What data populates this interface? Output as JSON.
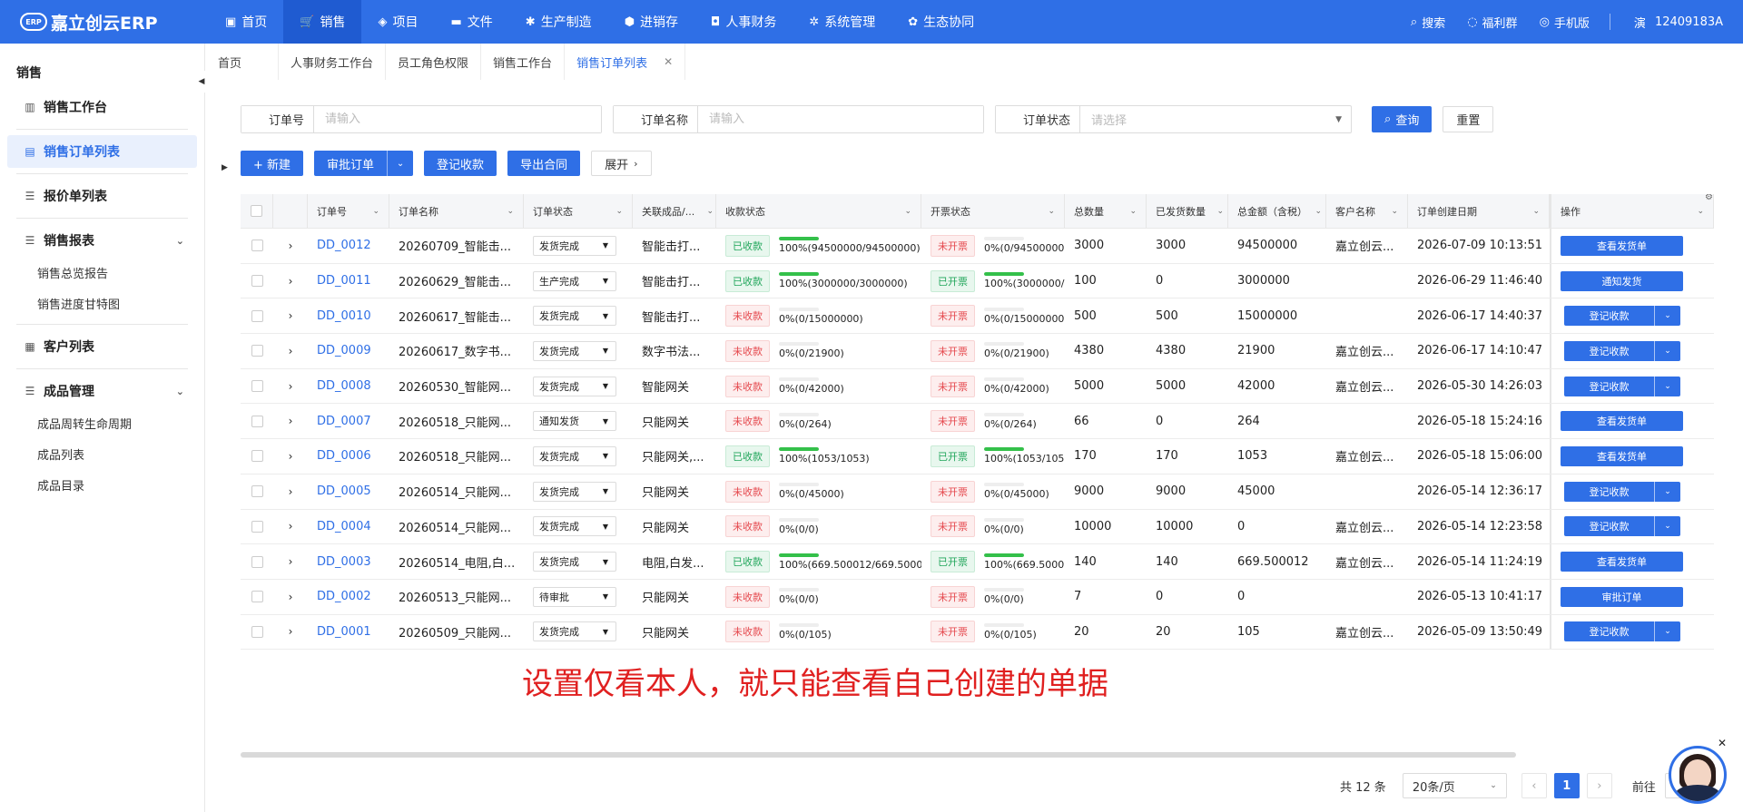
{
  "app": {
    "logo_badge": "ERP",
    "logo_text": "嘉立创云ERP"
  },
  "nav": [
    {
      "label": "首页",
      "icon": "monitor-icon",
      "glyph": "▣"
    },
    {
      "label": "销售",
      "icon": "cart-icon",
      "glyph": "🛒"
    },
    {
      "label": "项目",
      "icon": "layers-icon",
      "glyph": "◈"
    },
    {
      "label": "文件",
      "icon": "folder-icon",
      "glyph": "▬"
    },
    {
      "label": "生产制造",
      "icon": "gear-icon",
      "glyph": "✱"
    },
    {
      "label": "进销存",
      "icon": "box-icon",
      "glyph": "⬢"
    },
    {
      "label": "人事财务",
      "icon": "badge-icon",
      "glyph": "◘"
    },
    {
      "label": "系统管理",
      "icon": "settings-icon",
      "glyph": "✲"
    },
    {
      "label": "生态协同",
      "icon": "network-icon",
      "glyph": "✿"
    }
  ],
  "top_right": {
    "search": "搜索",
    "welfare": "福利群",
    "mobile": "手机版",
    "user_badge": "演",
    "user_id": "12409183A"
  },
  "sidebar": {
    "title": "销售",
    "items": [
      {
        "label": "销售工作台",
        "icon": "chart-icon"
      },
      {
        "label": "销售订单列表",
        "icon": "document-icon"
      },
      {
        "label": "报价单列表",
        "icon": "list-icon"
      }
    ],
    "report_group": {
      "label": "销售报表",
      "subs": [
        "销售总览报告",
        "销售进度甘特图"
      ]
    },
    "customer": {
      "label": "客户列表"
    },
    "product_group": {
      "label": "成品管理",
      "subs": [
        "成品周转生命周期",
        "成品列表",
        "成品目录"
      ]
    }
  },
  "tabs": [
    "首页",
    "人事财务工作台",
    "员工角色权限",
    "销售工作台",
    "销售订单列表"
  ],
  "filter": {
    "order_no_label": "订单号",
    "order_no_placeholder": "请输入",
    "order_name_label": "订单名称",
    "order_name_placeholder": "请输入",
    "order_status_label": "订单状态",
    "order_status_placeholder": "请选择",
    "query": "查询",
    "reset": "重置"
  },
  "actions": {
    "new": "+ 新建",
    "approve": "审批订单",
    "register_payment": "登记收款",
    "export_contract": "导出合同",
    "expand": "展开"
  },
  "columns": [
    "订单号",
    "订单名称",
    "订单状态",
    "关联成品/...",
    "收款状态",
    "开票状态",
    "总数量",
    "已发货数量",
    "总金额（含税）",
    "客户名称",
    "订单创建日期",
    "操作"
  ],
  "rows": [
    {
      "no": "DD_0012",
      "name": "20260709_智能击...",
      "status": "发货完成",
      "prod": "智能击打...",
      "pay_tag": "已收款",
      "pay_ok": true,
      "pay_pct": 1.0,
      "pay_text": "100%(94500000/94500000)",
      "inv_tag": "未开票",
      "inv_ok": false,
      "inv_pct": 0,
      "inv_text": "0%(0/94500000",
      "qty": "3000",
      "ship": "3000",
      "amt": "94500000",
      "cust": "嘉立创云...",
      "date": "2026-07-09 10:13:51",
      "op": "查看发货单",
      "op_split": false
    },
    {
      "no": "DD_0011",
      "name": "20260629_智能击...",
      "status": "生产完成",
      "prod": "智能击打...",
      "pay_tag": "已收款",
      "pay_ok": true,
      "pay_pct": 1.0,
      "pay_text": "100%(3000000/3000000)",
      "inv_tag": "已开票",
      "inv_ok": true,
      "inv_pct": 1.0,
      "inv_text": "100%(3000000/",
      "qty": "100",
      "ship": "0",
      "amt": "3000000",
      "cust": "",
      "date": "2026-06-29 11:46:40",
      "op": "通知发货",
      "op_split": false
    },
    {
      "no": "DD_0010",
      "name": "20260617_智能击...",
      "status": "发货完成",
      "prod": "智能击打...",
      "pay_tag": "未收款",
      "pay_ok": false,
      "pay_pct": 0,
      "pay_text": "0%(0/15000000)",
      "inv_tag": "未开票",
      "inv_ok": false,
      "inv_pct": 0,
      "inv_text": "0%(0/15000000",
      "qty": "500",
      "ship": "500",
      "amt": "15000000",
      "cust": "",
      "date": "2026-06-17 14:40:37",
      "op": "登记收款",
      "op_split": true
    },
    {
      "no": "DD_0009",
      "name": "20260617_数字书...",
      "status": "发货完成",
      "prod": "数字书法...",
      "pay_tag": "未收款",
      "pay_ok": false,
      "pay_pct": 0,
      "pay_text": "0%(0/21900)",
      "inv_tag": "未开票",
      "inv_ok": false,
      "inv_pct": 0,
      "inv_text": "0%(0/21900)",
      "qty": "4380",
      "ship": "4380",
      "amt": "21900",
      "cust": "嘉立创云...",
      "date": "2026-06-17 14:10:47",
      "op": "登记收款",
      "op_split": true
    },
    {
      "no": "DD_0008",
      "name": "20260530_智能网...",
      "status": "发货完成",
      "prod": "智能网关",
      "pay_tag": "未收款",
      "pay_ok": false,
      "pay_pct": 0,
      "pay_text": "0%(0/42000)",
      "inv_tag": "未开票",
      "inv_ok": false,
      "inv_pct": 0,
      "inv_text": "0%(0/42000)",
      "qty": "5000",
      "ship": "5000",
      "amt": "42000",
      "cust": "嘉立创云...",
      "date": "2026-05-30 14:26:03",
      "op": "登记收款",
      "op_split": true
    },
    {
      "no": "DD_0007",
      "name": "20260518_只能网...",
      "status": "通知发货",
      "prod": "只能网关",
      "pay_tag": "未收款",
      "pay_ok": false,
      "pay_pct": 0,
      "pay_text": "0%(0/264)",
      "inv_tag": "未开票",
      "inv_ok": false,
      "inv_pct": 0,
      "inv_text": "0%(0/264)",
      "qty": "66",
      "ship": "0",
      "amt": "264",
      "cust": "",
      "date": "2026-05-18 15:24:16",
      "op": "查看发货单",
      "op_split": false
    },
    {
      "no": "DD_0006",
      "name": "20260518_只能网...",
      "status": "发货完成",
      "prod": "只能网关,...",
      "pay_tag": "已收款",
      "pay_ok": true,
      "pay_pct": 1.0,
      "pay_text": "100%(1053/1053)",
      "inv_tag": "已开票",
      "inv_ok": true,
      "inv_pct": 1.0,
      "inv_text": "100%(1053/105",
      "qty": "170",
      "ship": "170",
      "amt": "1053",
      "cust": "嘉立创云...",
      "date": "2026-05-18 15:06:00",
      "op": "查看发货单",
      "op_split": false
    },
    {
      "no": "DD_0005",
      "name": "20260514_只能网...",
      "status": "发货完成",
      "prod": "只能网关",
      "pay_tag": "未收款",
      "pay_ok": false,
      "pay_pct": 0,
      "pay_text": "0%(0/45000)",
      "inv_tag": "未开票",
      "inv_ok": false,
      "inv_pct": 0,
      "inv_text": "0%(0/45000)",
      "qty": "9000",
      "ship": "9000",
      "amt": "45000",
      "cust": "",
      "date": "2026-05-14 12:36:17",
      "op": "登记收款",
      "op_split": true
    },
    {
      "no": "DD_0004",
      "name": "20260514_只能网...",
      "status": "发货完成",
      "prod": "只能网关",
      "pay_tag": "未收款",
      "pay_ok": false,
      "pay_pct": 0,
      "pay_text": "0%(0/0)",
      "inv_tag": "未开票",
      "inv_ok": false,
      "inv_pct": 0,
      "inv_text": "0%(0/0)",
      "qty": "10000",
      "ship": "10000",
      "amt": "0",
      "cust": "嘉立创云...",
      "date": "2026-05-14 12:23:58",
      "op": "登记收款",
      "op_split": true
    },
    {
      "no": "DD_0003",
      "name": "20260514_电阻,白...",
      "status": "发货完成",
      "prod": "电阻,白发...",
      "pay_tag": "已收款",
      "pay_ok": true,
      "pay_pct": 1.0,
      "pay_text": "100%(669.500012/669.5000",
      "inv_tag": "已开票",
      "inv_ok": true,
      "inv_pct": 1.0,
      "inv_text": "100%(669.5000",
      "qty": "140",
      "ship": "140",
      "amt": "669.500012",
      "cust": "嘉立创云...",
      "date": "2026-05-14 11:24:19",
      "op": "查看发货单",
      "op_split": false
    },
    {
      "no": "DD_0002",
      "name": "20260513_只能网...",
      "status": "待审批",
      "prod": "只能网关",
      "pay_tag": "未收款",
      "pay_ok": false,
      "pay_pct": 0,
      "pay_text": "0%(0/0)",
      "inv_tag": "未开票",
      "inv_ok": false,
      "inv_pct": 0,
      "inv_text": "0%(0/0)",
      "qty": "7",
      "ship": "0",
      "amt": "0",
      "cust": "",
      "date": "2026-05-13 10:41:17",
      "op": "审批订单",
      "op_split": false
    },
    {
      "no": "DD_0001",
      "name": "20260509_只能网...",
      "status": "发货完成",
      "prod": "只能网关",
      "pay_tag": "未收款",
      "pay_ok": false,
      "pay_pct": 0,
      "pay_text": "0%(0/105)",
      "inv_tag": "未开票",
      "inv_ok": false,
      "inv_pct": 0,
      "inv_text": "0%(0/105)",
      "qty": "20",
      "ship": "20",
      "amt": "105",
      "cust": "嘉立创云...",
      "date": "2026-05-09 13:50:49",
      "op": "登记收款",
      "op_split": true
    }
  ],
  "annotation": "设置仅看本人，就只能查看自己创建的单据",
  "pagination": {
    "total": "共 12 条",
    "page_size": "20条/页",
    "current": "1",
    "goto": "前往"
  },
  "colors": {
    "primary": "#2f6fe6",
    "success": "#21a65b",
    "danger": "#e5484d",
    "annotation": "#e02020"
  }
}
